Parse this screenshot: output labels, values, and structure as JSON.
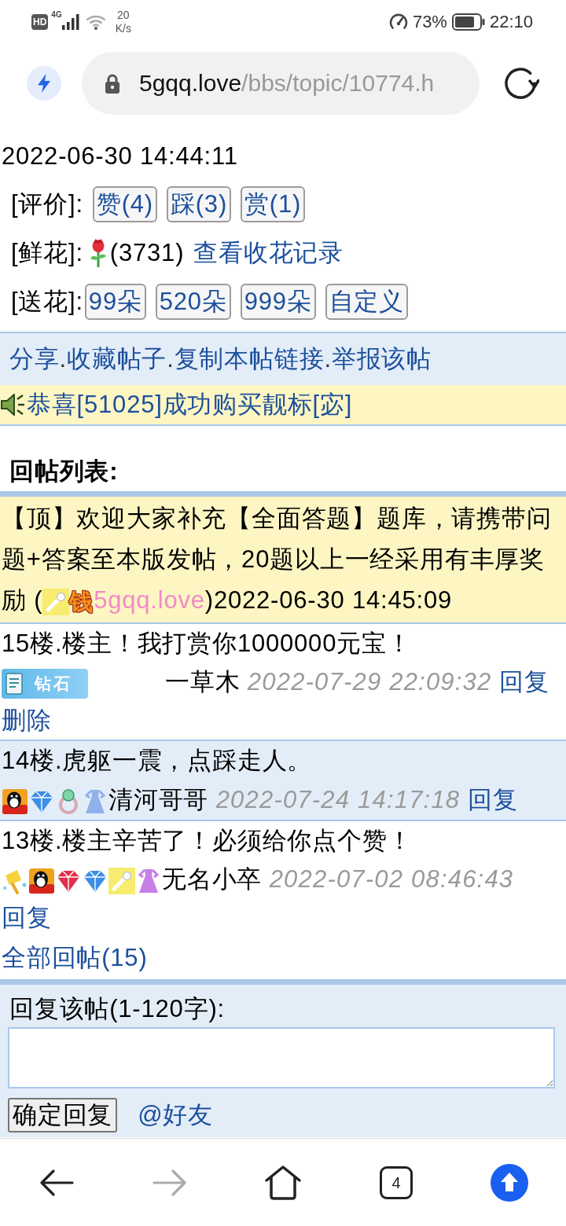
{
  "status_bar": {
    "hd": "HD",
    "network": "4G",
    "speed": "20",
    "speed_unit": "K/s",
    "battery": "73%",
    "time": "22:10"
  },
  "address_bar": {
    "domain": "5gqq.love",
    "path": "/bbs/topic/10774.h"
  },
  "topic": {
    "time": "2022-06-30 14:44:11",
    "rating": {
      "label": "[评价]:",
      "buttons": [
        "赞(4)",
        "踩(3)",
        "赏(1)"
      ]
    },
    "flowers": {
      "label": "[鲜花]:",
      "count": "(3731)",
      "link": "查看收花记录"
    },
    "send_flowers": {
      "label": "[送花]:",
      "buttons": [
        "99朵",
        "520朵",
        "999朵",
        "自定义"
      ]
    }
  },
  "share_bar": {
    "links": [
      {
        "label": "分享",
        "separator": "."
      },
      {
        "label": "收藏帖子",
        "separator": "."
      },
      {
        "label": "复制本帖链接",
        "separator": "."
      },
      {
        "label": "举报该帖"
      }
    ]
  },
  "notice": {
    "text": "恭喜[51025]成功购买靓标[宓]"
  },
  "reply_list": {
    "title": "回帖列表:",
    "pinned": {
      "text": "【顶】欢迎大家补充【全面答题】题库，请携带问题+答案至本版发帖，20题以上一经采用有丰厚奖励 (",
      "medals": [
        {
          "kind": "wand"
        },
        {
          "kind": "glyph",
          "label": "钱"
        }
      ],
      "author": "5gqq.love",
      "time": ")2022-06-30 14:45:09"
    },
    "replies": [
      {
        "text": "15楼.楼主！我打赏你1000000元宝！",
        "medals": [
          {
            "kind": "badge",
            "label": "钻石"
          }
        ],
        "author": "一草木",
        "time": "2022-07-29 22:09:32",
        "actions": [
          "回复",
          "删除"
        ]
      },
      {
        "text": "14楼.虎躯一震，点踩走人。",
        "medals": [
          {
            "kind": "penguin"
          },
          {
            "kind": "gem",
            "color": "#3d8ee6"
          },
          {
            "kind": "ring"
          },
          {
            "kind": "dress",
            "color": "#8fb2ea"
          }
        ],
        "author": "清河哥哥",
        "time": "2022-07-24 14:17:18",
        "actions": [
          "回复"
        ]
      },
      {
        "text": "13楼.楼主辛苦了！必须给你点个赞！",
        "medals": [
          {
            "kind": "torch"
          },
          {
            "kind": "penguin"
          },
          {
            "kind": "gem",
            "color": "#e0304a"
          },
          {
            "kind": "gem",
            "color": "#3d8ee6"
          },
          {
            "kind": "wand"
          },
          {
            "kind": "dress",
            "color": "#c77ee6"
          }
        ],
        "author": "无名小卒",
        "time": "2022-07-02 08:46:43",
        "actions": [
          "回复"
        ]
      }
    ],
    "all_replies": "全部回帖(15)"
  },
  "reply_form": {
    "label": "回复该帖(1-120字):",
    "submit": "确定回复",
    "mention": "@好友"
  },
  "nav_bar": {
    "items": [
      {
        "kind": "back",
        "disabled": false
      },
      {
        "kind": "forward",
        "disabled": true
      },
      {
        "kind": "home",
        "disabled": false
      },
      {
        "kind": "tabs",
        "label": "4",
        "disabled": false
      },
      {
        "kind": "scroll_top",
        "disabled": false
      }
    ]
  }
}
